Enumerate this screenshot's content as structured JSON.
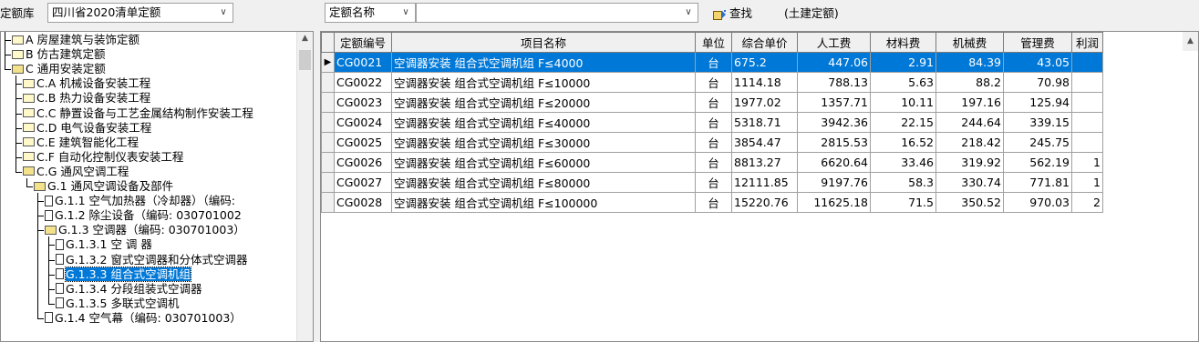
{
  "toolbar": {
    "library_label": "定额库",
    "library_value": "四川省2020清单定额",
    "filter_field_value": "定额名称",
    "search_value": "",
    "find_label": "查找",
    "scope_note": "(土建定额)"
  },
  "tree": [
    {
      "label": "A 房屋建筑与装饰定额",
      "type": "folder",
      "open": false
    },
    {
      "label": "B 仿古建筑定额",
      "type": "folder",
      "open": false
    },
    {
      "label": "C 通用安装定额",
      "type": "folder",
      "open": true
    },
    {
      "label": "C.A 机械设备安装工程",
      "type": "folder",
      "open": false
    },
    {
      "label": "C.B 热力设备安装工程",
      "type": "folder",
      "open": false
    },
    {
      "label": "C.C 静置设备与工艺金属结构制作安装工程",
      "type": "folder",
      "open": false
    },
    {
      "label": "C.D 电气设备安装工程",
      "type": "folder",
      "open": false
    },
    {
      "label": "C.E 建筑智能化工程",
      "type": "folder",
      "open": false
    },
    {
      "label": "C.F 自动化控制仪表安装工程",
      "type": "folder",
      "open": false
    },
    {
      "label": "C.G 通风空调工程",
      "type": "folder",
      "open": true
    },
    {
      "label": "G.1 通风空调设备及部件",
      "type": "folder",
      "open": true
    },
    {
      "label": "G.1.1 空气加热器（冷却器）（编码:",
      "type": "doc"
    },
    {
      "label": "G.1.2 除尘设备（编码: 030701002",
      "type": "doc"
    },
    {
      "label": "G.1.3 空调器（编码: 030701003）",
      "type": "folder",
      "open": true
    },
    {
      "label": "G.1.3.1 空 调 器",
      "type": "doc"
    },
    {
      "label": "G.1.3.2 窗式空调器和分体式空调器",
      "type": "doc"
    },
    {
      "label": "G.1.3.3 组合式空调机组",
      "type": "doc",
      "selected": true
    },
    {
      "label": "G.1.3.4 分段组装式空调器",
      "type": "doc"
    },
    {
      "label": "G.1.3.5 多联式空调机",
      "type": "doc"
    },
    {
      "label": "G.1.4 空气幕（编码: 030701003）",
      "type": "doc"
    }
  ],
  "grid": {
    "columns": [
      "定额编号",
      "项目名称",
      "单位",
      "综合单价",
      "人工费",
      "材料费",
      "机械费",
      "管理费",
      "利润"
    ],
    "rows": [
      [
        "CG0021",
        "空调器安装 组合式空调机组 F≤4000",
        "台",
        "675.2",
        "447.06",
        "2.91",
        "84.39",
        "43.05",
        ""
      ],
      [
        "CG0022",
        "空调器安装 组合式空调机组 F≤10000",
        "台",
        "1114.18",
        "788.13",
        "5.63",
        "88.2",
        "70.98",
        ""
      ],
      [
        "CG0023",
        "空调器安装 组合式空调机组 F≤20000",
        "台",
        "1977.02",
        "1357.71",
        "10.11",
        "197.16",
        "125.94",
        ""
      ],
      [
        "CG0024",
        "空调器安装 组合式空调机组 F≤40000",
        "台",
        "5318.71",
        "3942.36",
        "22.15",
        "244.64",
        "339.15",
        ""
      ],
      [
        "CG0025",
        "空调器安装 组合式空调机组 F≤30000",
        "台",
        "3854.47",
        "2815.53",
        "16.52",
        "218.42",
        "245.75",
        ""
      ],
      [
        "CG0026",
        "空调器安装 组合式空调机组 F≤60000",
        "台",
        "8813.27",
        "6620.64",
        "33.46",
        "319.92",
        "562.19",
        "1"
      ],
      [
        "CG0027",
        "空调器安装 组合式空调机组 F≤80000",
        "台",
        "12111.85",
        "9197.76",
        "58.3",
        "330.74",
        "771.81",
        "1"
      ],
      [
        "CG0028",
        "空调器安装 组合式空调机组 F≤100000",
        "台",
        "15220.76",
        "11625.18",
        "71.5",
        "350.52",
        "970.03",
        "2"
      ]
    ],
    "selected_row": 0
  }
}
